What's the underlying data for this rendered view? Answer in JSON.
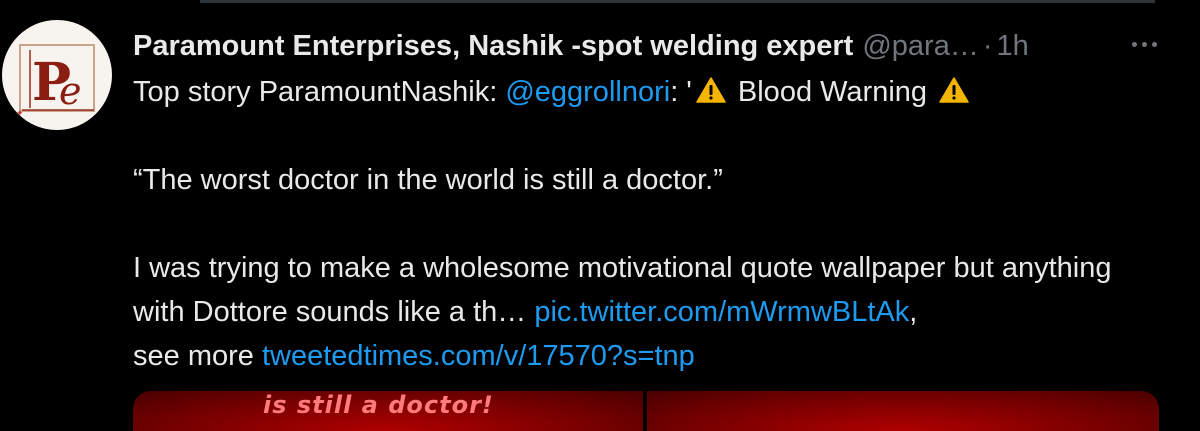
{
  "tweet": {
    "author_name": "Paramount Enterprises, Nashik -spot welding expert",
    "handle": "@para…",
    "separator": "·",
    "timestamp": "1h",
    "avatar_letters": "Pe",
    "line1_prefix": "Top story ParamountNashik: ",
    "mention": "@eggrollnori",
    "line1_mid": ": '",
    "line1_text": " Blood Warning ",
    "quote": "“The worst doctor in the world is still a doctor.”",
    "body_text": "I was trying to make a wholesome motivational quote wallpaper but anything with Dottore sounds like a th… ",
    "pic_link": "pic.twitter.com/mWrmwBLtAk",
    "after_pic": ",",
    "see_more": "see more ",
    "more_link": "tweetedtimes.com/v/17570?s=tnp",
    "media_caption": "is still a doctor!"
  },
  "colors": {
    "background": "#000000",
    "text": "#e7e9ea",
    "secondary": "#71767b",
    "link": "#1d9bf0",
    "warning": "#f4b400"
  },
  "icons": {
    "more": "more-dots-icon",
    "warning": "warning-sign-icon"
  }
}
